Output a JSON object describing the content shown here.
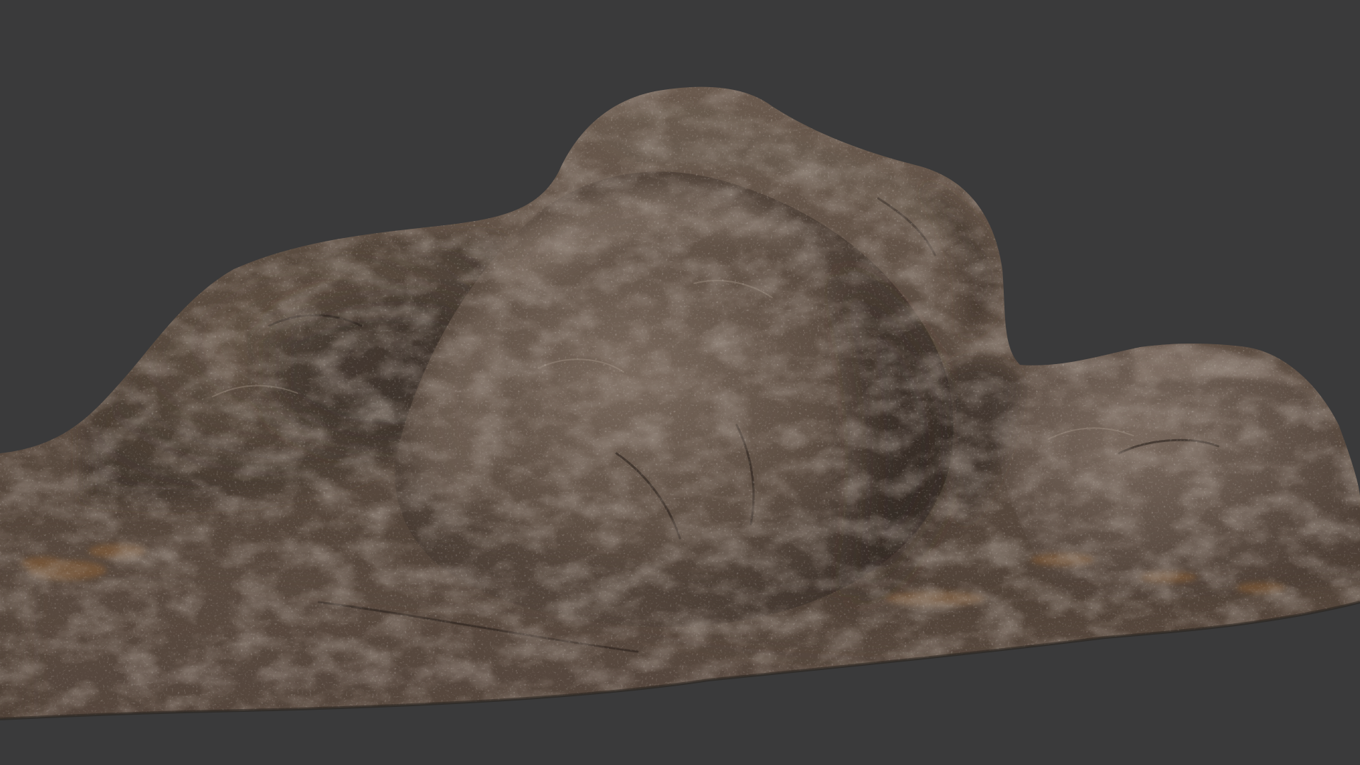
{
  "scene": {
    "subject": "rock-formation-3d-model",
    "colors": {
      "background": "#3a3a3b",
      "rock_base": "#5c4d42",
      "rock_light": "#8a7a6e",
      "rock_shadow": "#2f2722",
      "rock_highlight": "#a6968a",
      "rust_accent": "#8a5e34"
    }
  }
}
